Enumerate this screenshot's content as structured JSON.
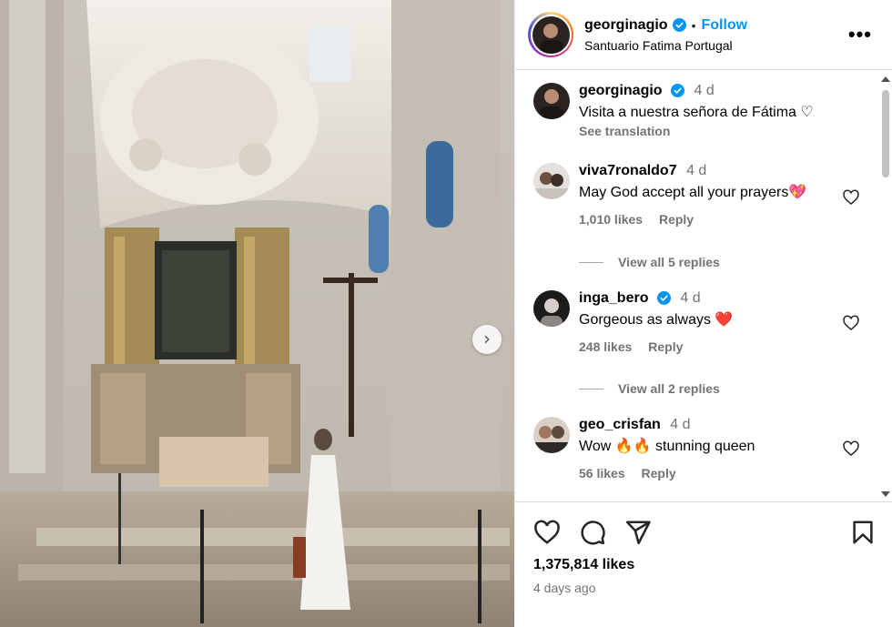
{
  "post": {
    "username": "georginagio",
    "follow_label": "Follow",
    "separator": "•",
    "location": "Santuario Fatima Portugal",
    "more_label": "•••"
  },
  "caption": {
    "username": "georginagio",
    "time": "4 d",
    "text": "Visita a nuestra señora de Fátima ♡",
    "see_translation": "See translation"
  },
  "comments": [
    {
      "username": "viva7ronaldo7",
      "time": "4 d",
      "text": "May God accept all your prayers💖",
      "likes": "1,010 likes",
      "reply": "Reply"
    },
    {
      "username": "inga_bero",
      "time": "4 d",
      "text": "Gorgeous as always ❤️",
      "likes": "248 likes",
      "reply": "Reply"
    },
    {
      "username": "geo_crisfan",
      "time": "4 d",
      "text": "Wow 🔥🔥 stunning queen",
      "likes": "56 likes",
      "reply": "Reply"
    }
  ],
  "replies": [
    {
      "label": "View all 5 replies"
    },
    {
      "label": "View all 2 replies"
    }
  ],
  "footer": {
    "likes_count": "1,375,814 likes",
    "posted": "4 days ago"
  },
  "colors": {
    "accent": "#0095f6",
    "verified": "#0095f6",
    "muted": "#737373"
  },
  "icons": [
    "chevron-right-icon",
    "verified-icon",
    "more-icon",
    "heart-icon",
    "comment-icon",
    "share-icon",
    "bookmark-icon"
  ]
}
